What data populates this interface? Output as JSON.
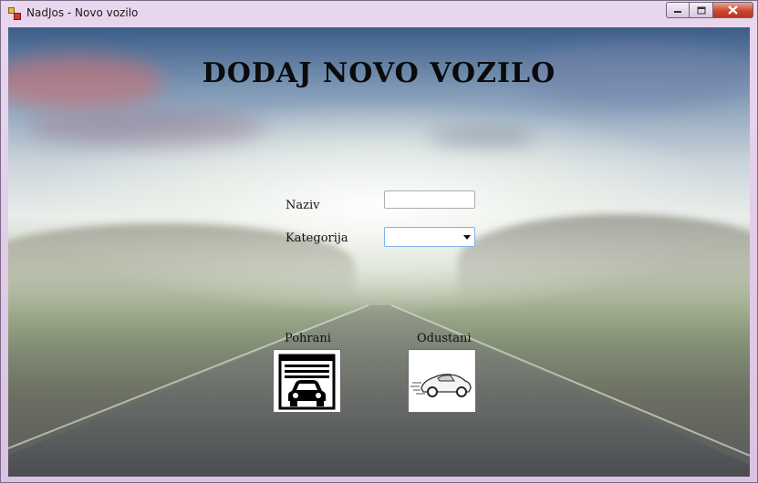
{
  "window": {
    "title": "NadJos - Novo vozilo",
    "controls": {
      "minimize": "▭",
      "maximize": "□",
      "close": "✕"
    }
  },
  "form": {
    "heading": "DODAJ NOVO VOZILO",
    "naziv_label": "Naziv",
    "naziv_value": "",
    "kategorija_label": "Kategorija",
    "kategorija_value": ""
  },
  "buttons": {
    "pohrani_label": "Pohrani",
    "pohrani_icon": "garage-car-icon",
    "odustani_label": "Odustani",
    "odustani_icon": "speeding-car-icon"
  }
}
